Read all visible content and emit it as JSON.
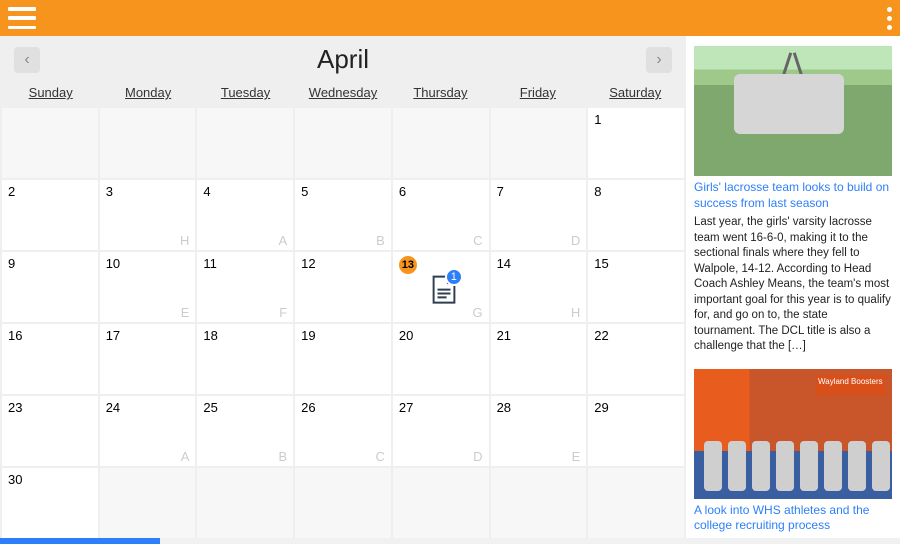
{
  "header": {
    "app_menu": "menu",
    "kebab": "more"
  },
  "calendar": {
    "month_title": "April",
    "prev_icon": "‹",
    "next_icon": "›",
    "weekdays": [
      "Sunday",
      "Monday",
      "Tuesday",
      "Wednesday",
      "Thursday",
      "Friday",
      "Saturday"
    ],
    "weeks": [
      [
        {
          "day": "",
          "letter": ""
        },
        {
          "day": "",
          "letter": ""
        },
        {
          "day": "",
          "letter": ""
        },
        {
          "day": "",
          "letter": ""
        },
        {
          "day": "",
          "letter": ""
        },
        {
          "day": "",
          "letter": ""
        },
        {
          "day": "1",
          "letter": ""
        }
      ],
      [
        {
          "day": "2",
          "letter": ""
        },
        {
          "day": "3",
          "letter": "H"
        },
        {
          "day": "4",
          "letter": "A"
        },
        {
          "day": "5",
          "letter": "B"
        },
        {
          "day": "6",
          "letter": "C"
        },
        {
          "day": "7",
          "letter": "D"
        },
        {
          "day": "8",
          "letter": ""
        }
      ],
      [
        {
          "day": "9",
          "letter": ""
        },
        {
          "day": "10",
          "letter": "E"
        },
        {
          "day": "11",
          "letter": "F"
        },
        {
          "day": "12",
          "letter": ""
        },
        {
          "day": "13",
          "letter": "G",
          "today": true,
          "docs": "1"
        },
        {
          "day": "14",
          "letter": "H"
        },
        {
          "day": "15",
          "letter": ""
        }
      ],
      [
        {
          "day": "16",
          "letter": ""
        },
        {
          "day": "17",
          "letter": ""
        },
        {
          "day": "18",
          "letter": ""
        },
        {
          "day": "19",
          "letter": ""
        },
        {
          "day": "20",
          "letter": ""
        },
        {
          "day": "21",
          "letter": ""
        },
        {
          "day": "22",
          "letter": ""
        }
      ],
      [
        {
          "day": "23",
          "letter": ""
        },
        {
          "day": "24",
          "letter": "A"
        },
        {
          "day": "25",
          "letter": "B"
        },
        {
          "day": "26",
          "letter": "C"
        },
        {
          "day": "27",
          "letter": "D"
        },
        {
          "day": "28",
          "letter": "E"
        },
        {
          "day": "29",
          "letter": ""
        }
      ],
      [
        {
          "day": "30",
          "letter": ""
        },
        {
          "day": "",
          "letter": ""
        },
        {
          "day": "",
          "letter": ""
        },
        {
          "day": "",
          "letter": ""
        },
        {
          "day": "",
          "letter": ""
        },
        {
          "day": "",
          "letter": ""
        },
        {
          "day": "",
          "letter": ""
        }
      ]
    ]
  },
  "sidebar": {
    "stories": [
      {
        "title": "Girls' lacrosse team looks to build on success from last season",
        "excerpt": "Last year, the girls' varsity lacrosse team went 16-6-0, making it to the sectional finals where they fell to Walpole, 14-12. According to Head Coach Ashley Means, the team's most important goal for this year is to qualify for, and go on to, the state tournament. The DCL title is also a challenge that the […]"
      },
      {
        "title": "A look into WHS athletes and the college recruiting process",
        "excerpt": "",
        "banner": "Wayland Boosters"
      }
    ]
  }
}
